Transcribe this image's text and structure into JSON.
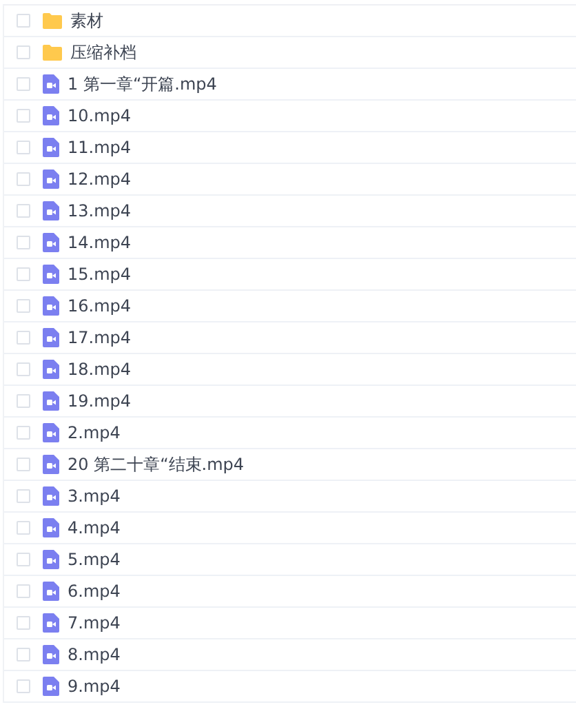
{
  "files": [
    {
      "kind": "folder",
      "name": "素材",
      "checked": false
    },
    {
      "kind": "folder",
      "name": "压缩补档",
      "checked": false
    },
    {
      "kind": "video",
      "name": "1 第一章“开篇.mp4",
      "checked": false
    },
    {
      "kind": "video",
      "name": "10.mp4",
      "checked": false
    },
    {
      "kind": "video",
      "name": "11.mp4",
      "checked": false
    },
    {
      "kind": "video",
      "name": "12.mp4",
      "checked": false
    },
    {
      "kind": "video",
      "name": "13.mp4",
      "checked": false
    },
    {
      "kind": "video",
      "name": "14.mp4",
      "checked": false
    },
    {
      "kind": "video",
      "name": "15.mp4",
      "checked": false
    },
    {
      "kind": "video",
      "name": "16.mp4",
      "checked": false
    },
    {
      "kind": "video",
      "name": "17.mp4",
      "checked": false
    },
    {
      "kind": "video",
      "name": "18.mp4",
      "checked": false
    },
    {
      "kind": "video",
      "name": "19.mp4",
      "checked": false
    },
    {
      "kind": "video",
      "name": "2.mp4",
      "checked": false
    },
    {
      "kind": "video",
      "name": "20 第二十章“结束.mp4",
      "checked": false
    },
    {
      "kind": "video",
      "name": "3.mp4",
      "checked": false
    },
    {
      "kind": "video",
      "name": "4.mp4",
      "checked": false
    },
    {
      "kind": "video",
      "name": "5.mp4",
      "checked": false
    },
    {
      "kind": "video",
      "name": "6.mp4",
      "checked": false
    },
    {
      "kind": "video",
      "name": "7.mp4",
      "checked": false
    },
    {
      "kind": "video",
      "name": "8.mp4",
      "checked": false
    },
    {
      "kind": "video",
      "name": "9.mp4",
      "checked": false
    }
  ]
}
